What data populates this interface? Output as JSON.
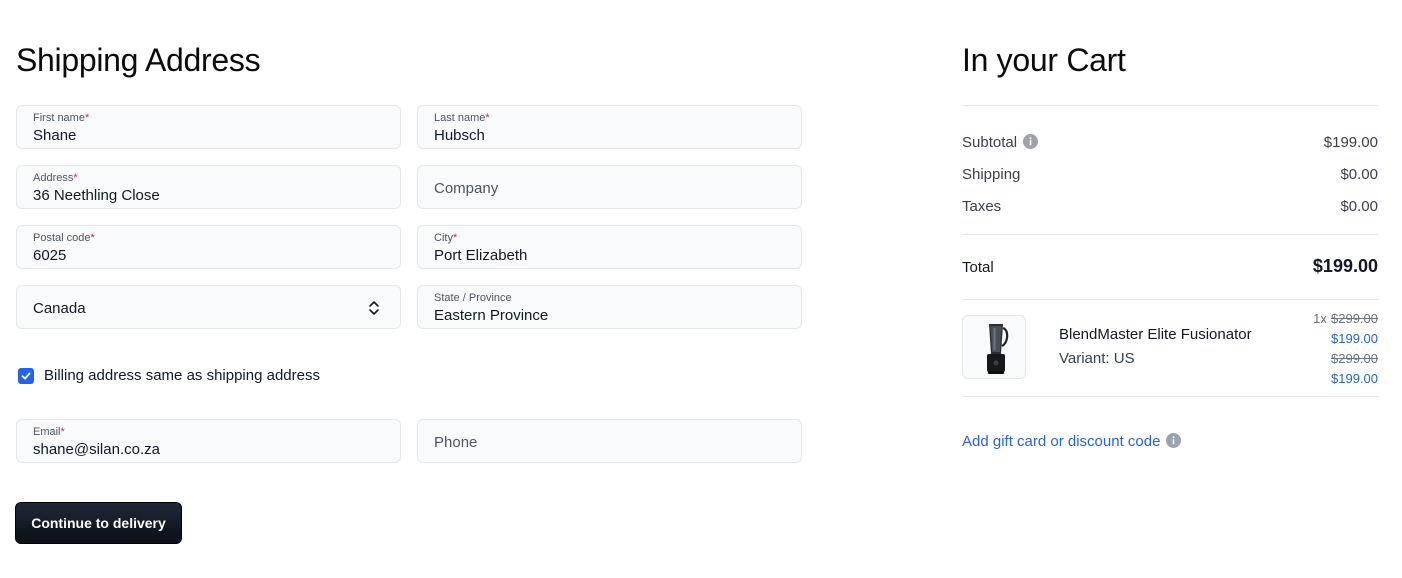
{
  "shipping": {
    "title": "Shipping Address",
    "first_name": {
      "label": "First name",
      "value": "Shane"
    },
    "last_name": {
      "label": "Last name",
      "value": "Hubsch"
    },
    "address": {
      "label": "Address",
      "value": "36 Neethling Close"
    },
    "company": {
      "placeholder": "Company"
    },
    "postal_code": {
      "label": "Postal code",
      "value": "6025"
    },
    "city": {
      "label": "City",
      "value": "Port Elizabeth"
    },
    "country": {
      "selected": "Canada"
    },
    "state": {
      "label": "State / Province",
      "value": "Eastern Province"
    },
    "required_mark": "*",
    "billing_same": {
      "label": "Billing address same as shipping address",
      "checked": true
    },
    "email": {
      "label": "Email",
      "value": "shane@silan.co.za"
    },
    "phone": {
      "placeholder": "Phone"
    },
    "continue_label": "Continue to delivery"
  },
  "cart": {
    "title": "In your Cart",
    "subtotal": {
      "label": "Subtotal",
      "value": "$199.00"
    },
    "shipping": {
      "label": "Shipping",
      "value": "$0.00"
    },
    "taxes": {
      "label": "Taxes",
      "value": "$0.00"
    },
    "total": {
      "label": "Total",
      "value": "$199.00"
    },
    "item": {
      "name": "BlendMaster Elite Fusionator",
      "variant": "Variant: US",
      "quantity": "1x",
      "unit_original": "$299.00",
      "unit_price": "$199.00",
      "total_original": "$299.00",
      "total_price": "$199.00"
    },
    "gift_card_link": "Add gift card or discount code"
  },
  "colors": {
    "accent": "#2563eb",
    "required": "#e11d48",
    "button": "#111827"
  },
  "icons": [
    "check-icon",
    "chevron-up-down-icon",
    "info-icon",
    "blender-product-image"
  ]
}
